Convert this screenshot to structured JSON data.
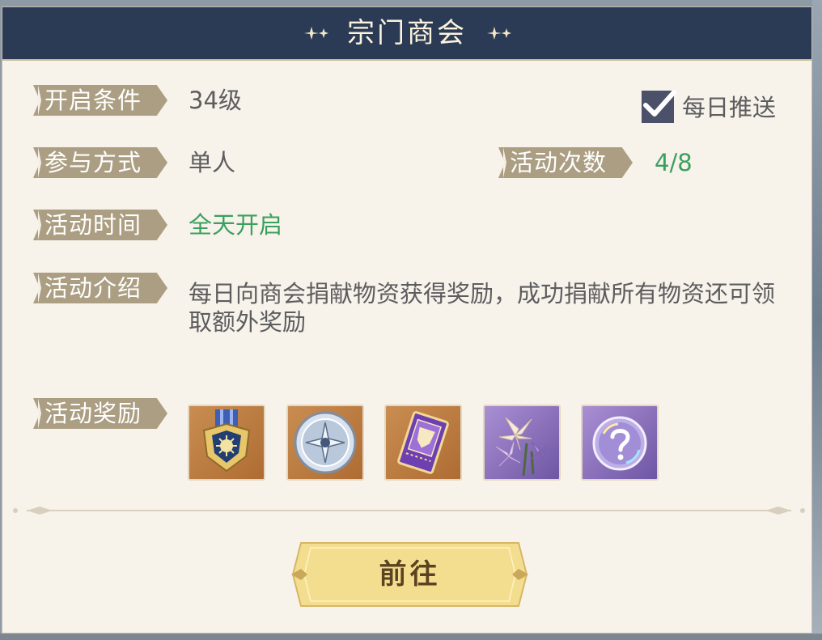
{
  "panel": {
    "title": "宗门商会",
    "daily_push_label": "每日推送",
    "daily_push_checked": true,
    "rows": {
      "condition": {
        "label": "开启条件",
        "value": "34级"
      },
      "mode": {
        "label": "参与方式",
        "value": "单人"
      },
      "count": {
        "label": "活动次数",
        "value": "4/8"
      },
      "time": {
        "label": "活动时间",
        "value": "全天开启"
      },
      "intro": {
        "label": "活动介绍",
        "value": "每日向商会捐献物资获得奖励，成功捐献所有物资还可领取额外奖励"
      },
      "rewards": {
        "label": "活动奖励"
      }
    },
    "rewards": [
      {
        "icon": "medal-icon",
        "bg": "orange"
      },
      {
        "icon": "silver-coin-icon",
        "bg": "orange"
      },
      {
        "icon": "ticket-icon",
        "bg": "orange"
      },
      {
        "icon": "lily-flower-icon",
        "bg": "purple"
      },
      {
        "icon": "mystery-orb-icon",
        "bg": "purple"
      }
    ],
    "go_button": "前往"
  },
  "colors": {
    "header": "#2c3b55",
    "panel_bg": "#f7f2ea",
    "label_tag": "#ab9e82",
    "accent_green": "#3aa05e",
    "button_gold": "#f3de8f"
  }
}
